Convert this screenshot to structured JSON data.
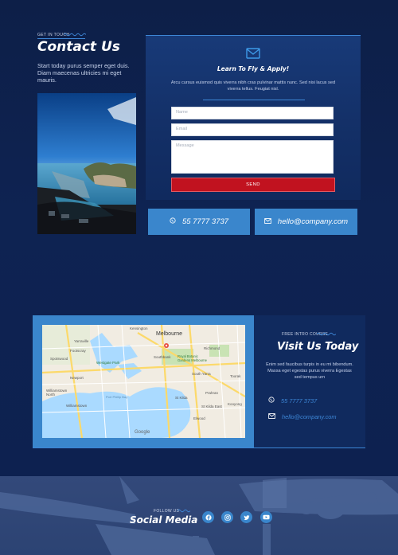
{
  "colors": {
    "navy": "#0c1f4a",
    "card": "#102a5e",
    "accent": "#3a86cc",
    "send": "#c1121f"
  },
  "contact": {
    "eyebrow": "GET IN TOUCH",
    "title": "Contact Us",
    "intro": "Start today purus semper eget duis. Diam maecenas ultricies mi eget mauris."
  },
  "form": {
    "icon": "envelope-icon",
    "title": "Learn To Fly & Apply!",
    "description": "Arcu cursus euismod quis viverra nibh cras pulvinar mattis nunc. Sed nisi lacus sed viverra tellus. Feugiat nisl.",
    "name_placeholder": "Name",
    "email_placeholder": "Email",
    "message_placeholder": "Message",
    "send_label": "SEND"
  },
  "contact_boxes": {
    "phone": "55 7777 3737",
    "email": "hello@company.com"
  },
  "visit": {
    "eyebrow": "FREE INTRO COURSE",
    "title": "Visit Us Today",
    "description": "Enim sed faucibus turpis in eu mi bibendum. Massa eget egestas purus viverra Egestas sed tempus urn",
    "phone": "55 7777 3737",
    "email": "hello@company.com"
  },
  "map": {
    "city": "Melbourne",
    "labels": [
      "Yarraville",
      "Footscray",
      "Spotswood",
      "Newport",
      "Williamstown North",
      "Williamstown",
      "Southbank",
      "Richmond",
      "Royal Botanic Gardens Melbourne",
      "South Yarra",
      "St Kilda",
      "Prahran",
      "Toorak",
      "Elwood",
      "St Kilda East",
      "Port Phillip Bay",
      "Kensington",
      "Westgate Park",
      "Kooyong"
    ],
    "attribution": "Google"
  },
  "footer": {
    "eyebrow": "FOLLOW US",
    "title": "Social Media",
    "icons": [
      "facebook-icon",
      "instagram-icon",
      "twitter-icon",
      "youtube-icon"
    ]
  }
}
